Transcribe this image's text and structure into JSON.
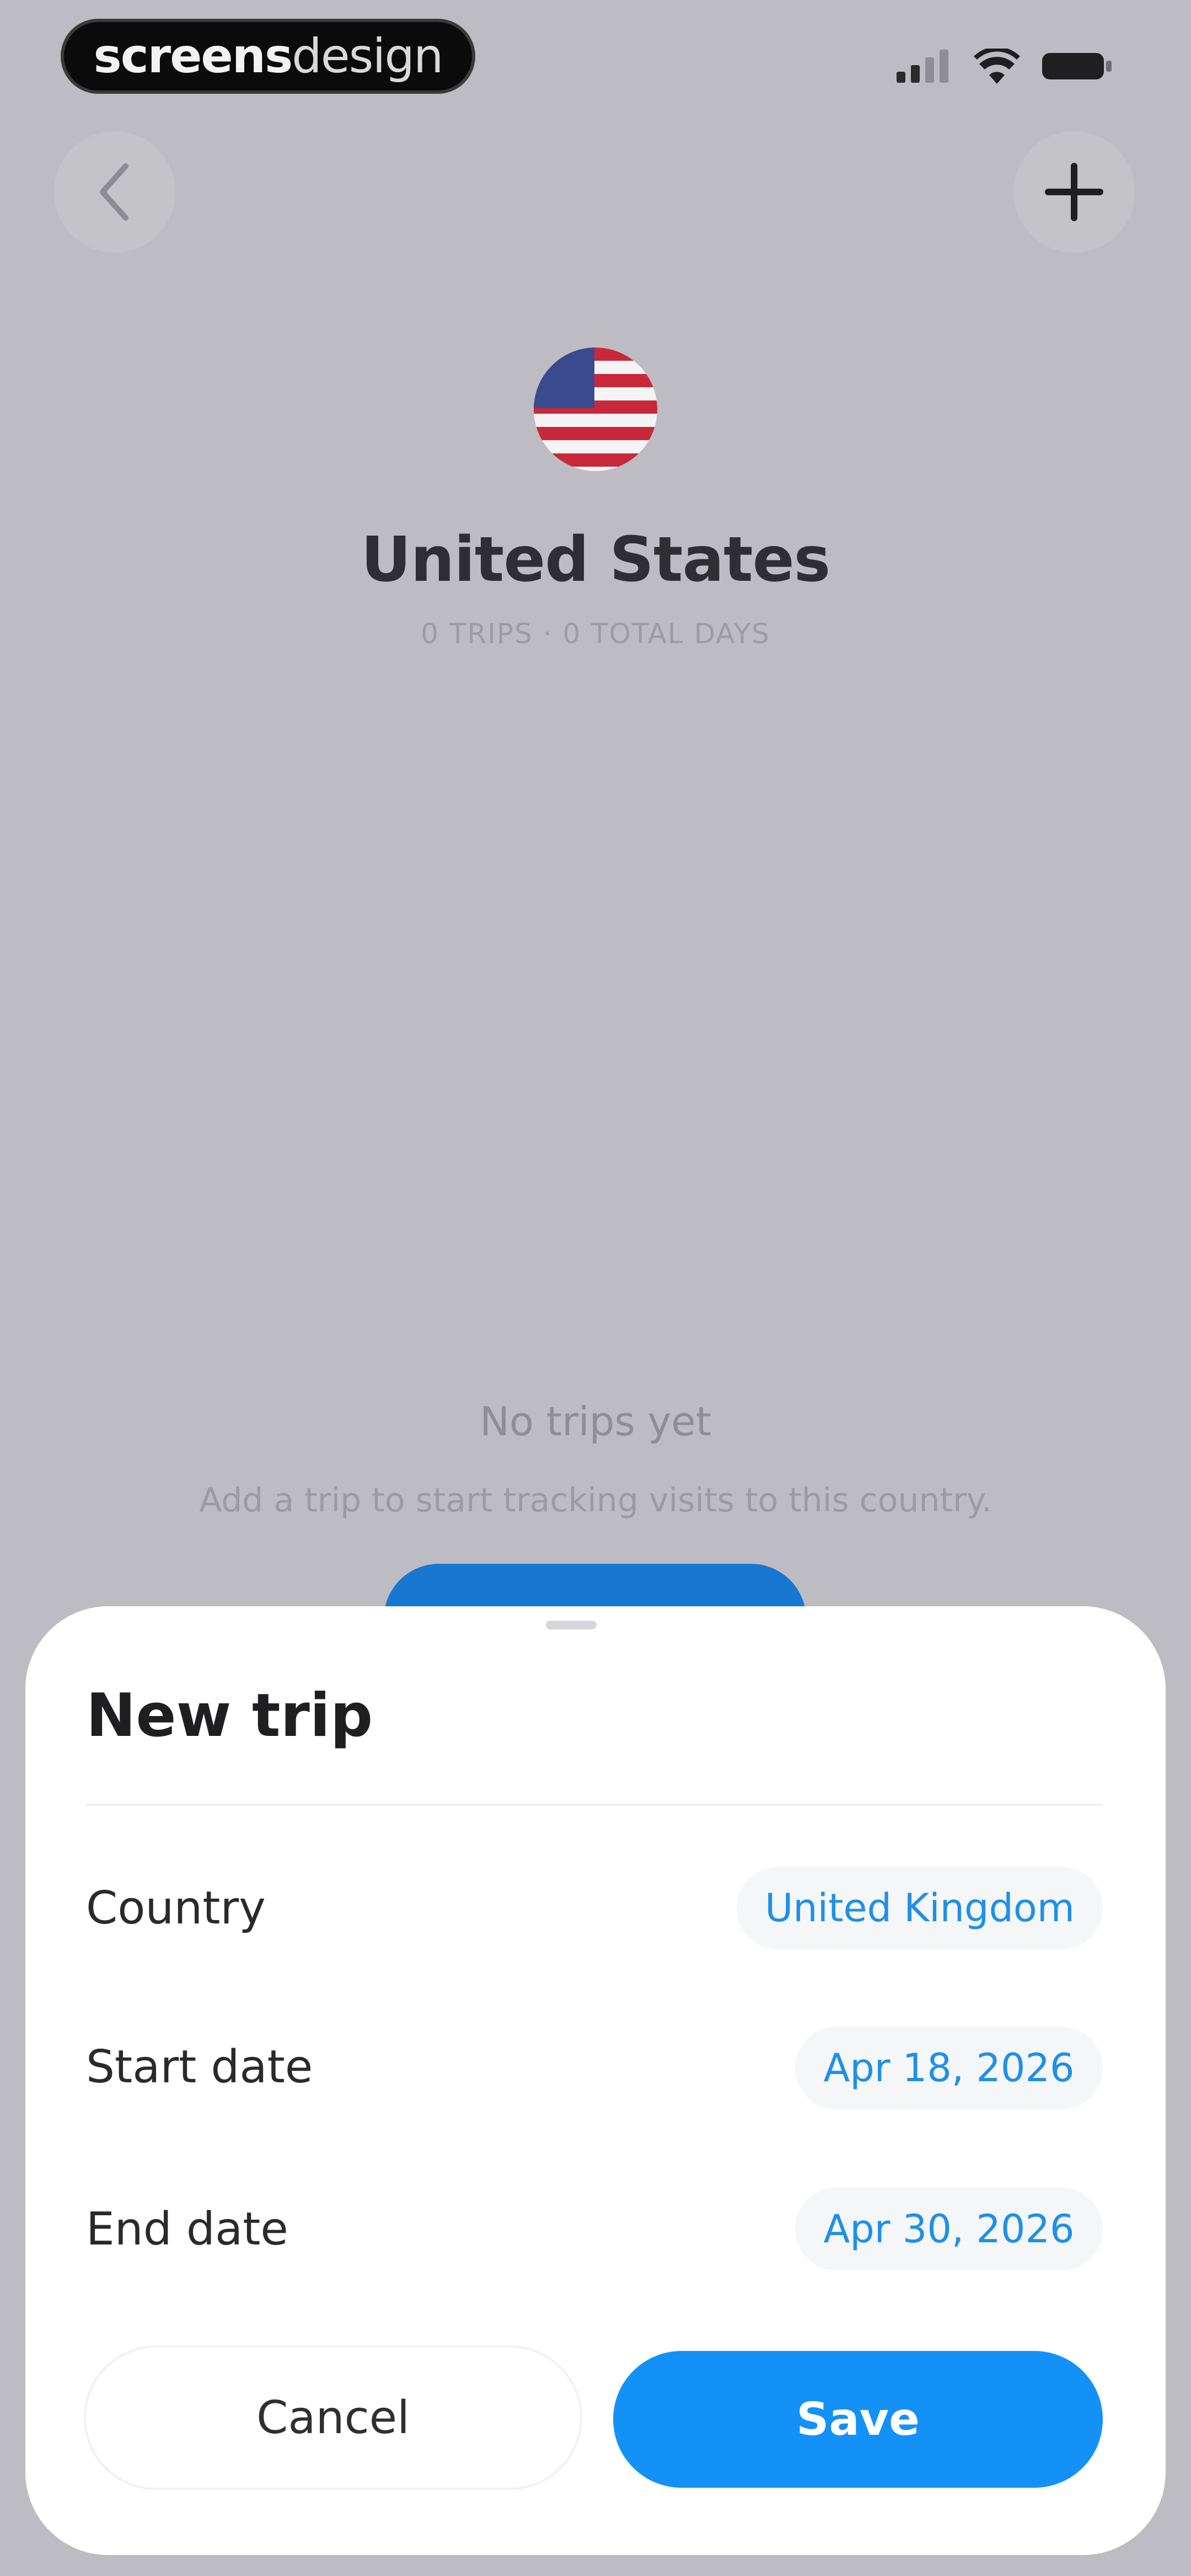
{
  "watermark": {
    "bold": "screens",
    "light": "design"
  },
  "status_bar": {
    "icons": [
      "cellular-signal-icon",
      "wifi-icon",
      "battery-icon"
    ]
  },
  "header": {
    "back_icon": "chevron-left-icon",
    "add_icon": "plus-icon"
  },
  "country": {
    "flag_icon": "us-flag-icon",
    "name": "United States",
    "summary": "0 TRIPS · 0 TOTAL DAYS"
  },
  "empty_state": {
    "title": "No trips yet",
    "description": "Add a trip to start tracking visits to this country."
  },
  "sheet": {
    "title": "New trip",
    "rows": [
      {
        "label": "Country",
        "value": "United Kingdom"
      },
      {
        "label": "Start date",
        "value": "Apr 18, 2026"
      },
      {
        "label": "End date",
        "value": "Apr 30, 2026"
      }
    ],
    "cancel_label": "Cancel",
    "save_label": "Save"
  },
  "colors": {
    "accent": "#1391F6",
    "background_dimmed": "#BDBCC2",
    "sheet": "#FFFFFF"
  }
}
